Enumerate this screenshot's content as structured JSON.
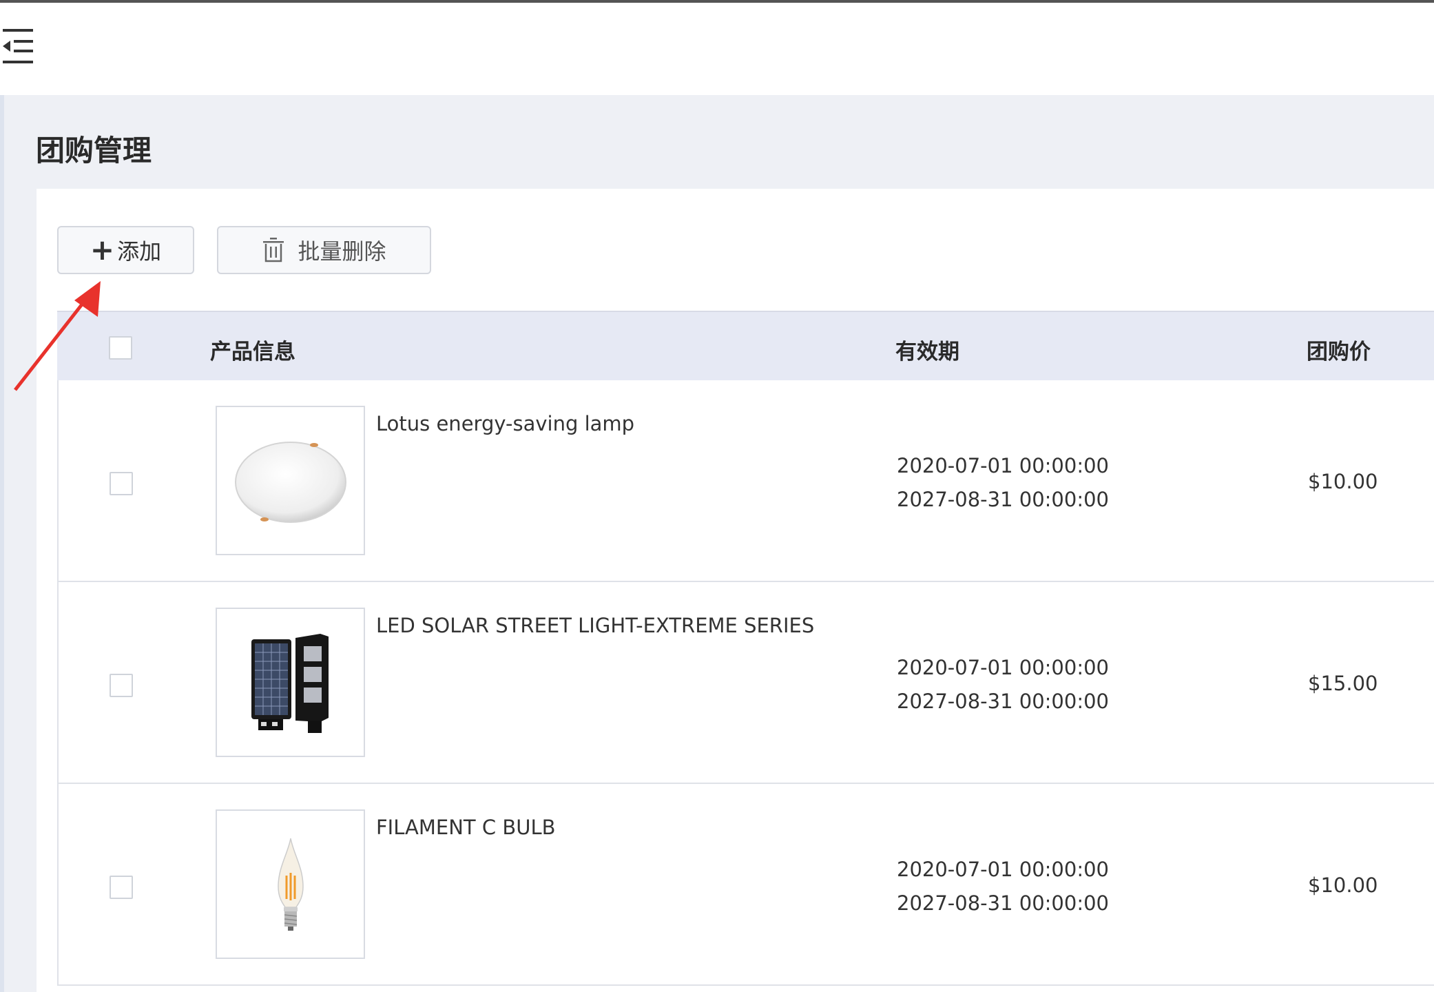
{
  "page": {
    "title": "团购管理"
  },
  "toolbar": {
    "add_label": "添加",
    "batch_delete_label": "批量删除"
  },
  "table": {
    "headers": {
      "product_info": "产品信息",
      "validity": "有效期",
      "group_price": "团购价"
    },
    "rows": [
      {
        "name": "Lotus energy-saving lamp",
        "start": "2020-07-01 00:00:00",
        "end": "2027-08-31 00:00:00",
        "price": "$10.00",
        "image": "round-led-panel-lamp"
      },
      {
        "name": "LED SOLAR STREET LIGHT-EXTREME SERIES",
        "start": "2020-07-01 00:00:00",
        "end": "2027-08-31 00:00:00",
        "price": "$15.00",
        "image": "solar-street-light"
      },
      {
        "name": "FILAMENT C BULB",
        "start": "2020-07-01 00:00:00",
        "end": "2027-08-31 00:00:00",
        "price": "$10.00",
        "image": "filament-candle-bulb"
      }
    ]
  },
  "colors": {
    "content_bg": "#eef0f5",
    "header_bg": "#e6e9f4",
    "annotation_arrow": "#e8322c"
  }
}
